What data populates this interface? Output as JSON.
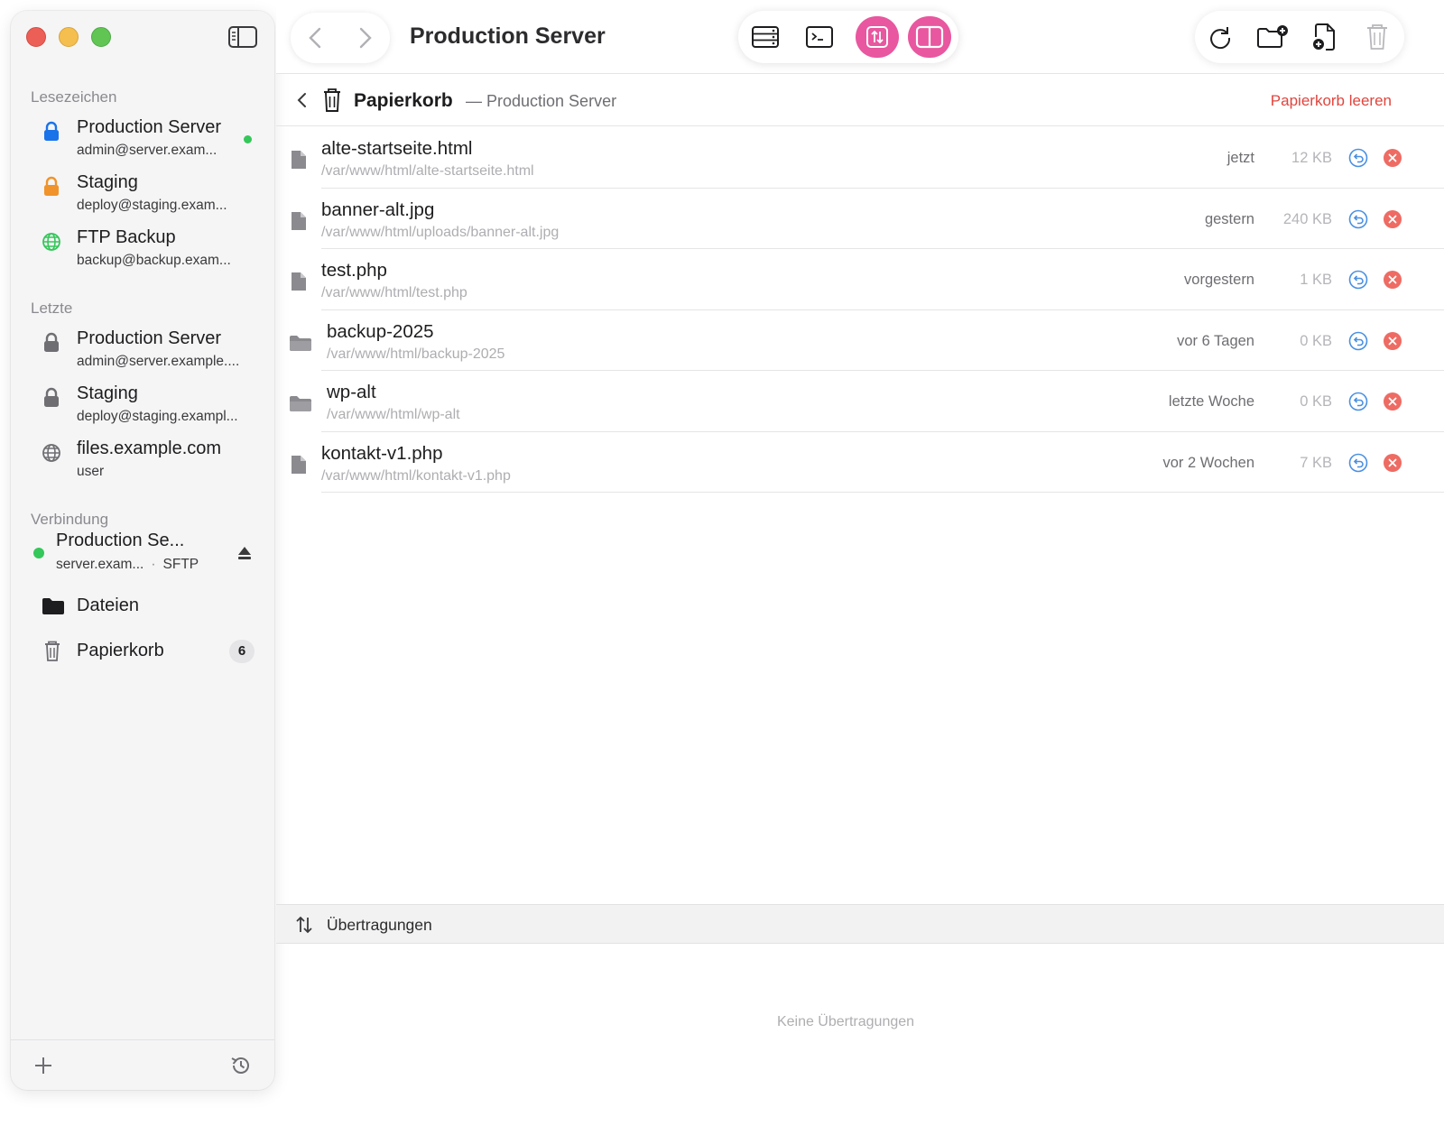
{
  "window": {
    "title": "Production Server"
  },
  "sidebar": {
    "bookmarks_title": "Lesezeichen",
    "bookmarks": [
      {
        "name": "Production Server",
        "detail": "admin@server.exam...",
        "icon": "lock-icon",
        "color": "#1a73e8",
        "online": true
      },
      {
        "name": "Staging",
        "detail": "deploy@staging.exam...",
        "icon": "lock-icon",
        "color": "#f0932b",
        "online": false
      },
      {
        "name": "FTP Backup",
        "detail": "backup@backup.exam...",
        "icon": "globe-icon",
        "color": "#34c759",
        "online": false
      }
    ],
    "recent_title": "Letzte",
    "recent": [
      {
        "name": "Production Server",
        "detail": "admin@server.example...."
      },
      {
        "name": "Staging",
        "detail": "deploy@staging.exampl..."
      },
      {
        "name": "files.example.com",
        "detail": "user"
      }
    ],
    "connection_title": "Verbindung",
    "connection": {
      "name": "Production Se...",
      "host": "server.exam...",
      "sep": "·",
      "protocol": "SFTP"
    },
    "nav": {
      "files": "Dateien",
      "trash": "Papierkorb",
      "trash_count": "6"
    }
  },
  "header": {
    "title": "Papierkorb",
    "subtitle": "— Production Server",
    "empty_action": "Papierkorb leeren"
  },
  "files": [
    {
      "name": "alte-startseite.html",
      "path": "/var/www/html/alte-startseite.html",
      "date": "jetzt",
      "size": "12 KB",
      "kind": "file"
    },
    {
      "name": "banner-alt.jpg",
      "path": "/var/www/html/uploads/banner-alt.jpg",
      "date": "gestern",
      "size": "240 KB",
      "kind": "file"
    },
    {
      "name": "test.php",
      "path": "/var/www/html/test.php",
      "date": "vorgestern",
      "size": "1 KB",
      "kind": "file"
    },
    {
      "name": "backup-2025",
      "path": "/var/www/html/backup-2025",
      "date": "vor 6 Tagen",
      "size": "0 KB",
      "kind": "folder"
    },
    {
      "name": "wp-alt",
      "path": "/var/www/html/wp-alt",
      "date": "letzte Woche",
      "size": "0 KB",
      "kind": "folder"
    },
    {
      "name": "kontakt-v1.php",
      "path": "/var/www/html/kontakt-v1.php",
      "date": "vor 2 Wochen",
      "size": "7 KB",
      "kind": "file"
    }
  ],
  "transfers": {
    "title": "Übertragungen",
    "empty": "Keine Übertragungen"
  },
  "colors": {
    "accent_pink": "#e8579f",
    "danger": "#e0453d",
    "restore_blue": "#4a90e2",
    "online_green": "#34c759"
  }
}
